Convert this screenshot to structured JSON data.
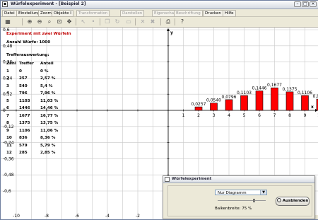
{
  "window": {
    "title": "Würfelexperiment - [Beispiel 2]"
  },
  "menu": [
    {
      "label": "Datei",
      "enabled": true
    },
    {
      "label": "Einstellungen",
      "enabled": true
    },
    {
      "label": "Zoom",
      "enabled": true
    },
    {
      "label": "Objekte I",
      "enabled": true
    },
    {
      "label": "Transformation",
      "enabled": false
    },
    {
      "label": "Darstellen",
      "enabled": false
    },
    {
      "label": "Eigenschaft",
      "enabled": false
    },
    {
      "label": "Beschriftung",
      "enabled": false
    },
    {
      "label": "Drucken",
      "enabled": true
    },
    {
      "label": "Hilfe",
      "enabled": true
    }
  ],
  "toolbar": [
    {
      "icon": "calculator-icon",
      "glyph": "▦",
      "enabled": true
    },
    {
      "icon": "zoom-in-icon",
      "glyph": "⊕",
      "enabled": true
    },
    {
      "icon": "zoom-out-icon",
      "glyph": "⊖",
      "enabled": true
    },
    {
      "icon": "zoom-area-icon",
      "glyph": "⌕",
      "enabled": true
    },
    {
      "icon": "zoom-fit-icon",
      "glyph": "⊡",
      "enabled": true
    },
    {
      "icon": "move-icon",
      "glyph": "✥",
      "enabled": true
    },
    {
      "icon": "pointer-icon",
      "glyph": "↖",
      "enabled": false
    },
    {
      "icon": "point-icon",
      "glyph": "•",
      "enabled": false
    },
    {
      "icon": "copy-icon",
      "glyph": "❐",
      "enabled": false
    },
    {
      "icon": "refresh-icon",
      "glyph": "↻",
      "enabled": false
    },
    {
      "icon": "paste-icon",
      "glyph": "▭",
      "enabled": false
    },
    {
      "icon": "delete-icon",
      "glyph": "✕",
      "enabled": false
    },
    {
      "icon": "delete-all-icon",
      "glyph": "✖",
      "enabled": false
    },
    {
      "icon": "print-icon",
      "glyph": "⎙",
      "enabled": true
    },
    {
      "icon": "help-icon",
      "glyph": "?",
      "enabled": true
    }
  ],
  "experiment": {
    "title": "Experiment mit zwei Würfeln",
    "count_text": "Anzahl Würfe: 1000",
    "table_title": "Trefferauswertung:",
    "headers": [
      "Zahl",
      "Treffer",
      "Anteil"
    ],
    "rows": [
      [
        "1",
        "0",
        "0 %"
      ],
      [
        "2",
        "257",
        "2,57 %"
      ],
      [
        "3",
        "540",
        "5,4 %"
      ],
      [
        "4",
        "796",
        "7,96 %"
      ],
      [
        "5",
        "1103",
        "11,03 %"
      ],
      [
        "6",
        "1446",
        "14,46 %"
      ],
      [
        "7",
        "1677",
        "16,77 %"
      ],
      [
        "8",
        "1375",
        "13,75 %"
      ],
      [
        "9",
        "1106",
        "11,06 %"
      ],
      [
        "10",
        "836",
        "8,36 %"
      ],
      [
        "11",
        "579",
        "5,79 %"
      ],
      [
        "12",
        "285",
        "2,85 %"
      ]
    ]
  },
  "chart_data": {
    "type": "bar",
    "x": [
      2,
      3,
      4,
      5,
      6,
      7,
      8,
      9,
      10,
      11
    ],
    "values": [
      0.0257,
      0.054,
      0.0796,
      0.1103,
      0.1446,
      0.1677,
      0.1375,
      0.1106,
      0.0836,
      0.0579
    ],
    "labels": [
      "0,0257",
      "0,0540",
      "0,0796",
      "0,1103",
      "0,1446",
      "0,1677",
      "0,1375",
      "0,1106",
      "0,0836",
      "0,0"
    ],
    "xlabel": "x",
    "ylabel": "y",
    "xlim": [
      -10.5,
      12.5
    ],
    "ylim": [
      -0.61,
      0.61
    ],
    "x_ticks": [
      -10,
      -8,
      -6,
      -4,
      -2,
      1,
      2,
      3,
      4,
      5,
      6,
      7,
      8,
      9,
      10
    ],
    "x_tick_labels": [
      "-10",
      "-8",
      "-6",
      "-4",
      "-2",
      "1",
      "2",
      "3",
      "4",
      "5",
      "6",
      "7",
      "8",
      "9",
      "10"
    ],
    "y_ticks": [
      0.6,
      0.48,
      0.36,
      0.24,
      0.12,
      0,
      -0.12,
      -0.24,
      -0.36,
      -0.48,
      -0.6
    ],
    "y_tick_labels": [
      "0,6",
      "0,48",
      "0,36",
      "0,24",
      "0,12",
      "0",
      "-0,12",
      "-0,24",
      "-0,36",
      "-0,48",
      "-0,6"
    ],
    "grid": true,
    "bar_color": "#ff0000"
  },
  "panel": {
    "title": "Würfelexperiment",
    "select_value": "Nur Diagramm",
    "bar_width_label": "Balkenbreite:  75 %",
    "bar_width_value": 0.75,
    "hide_button": "Ausblenden"
  }
}
